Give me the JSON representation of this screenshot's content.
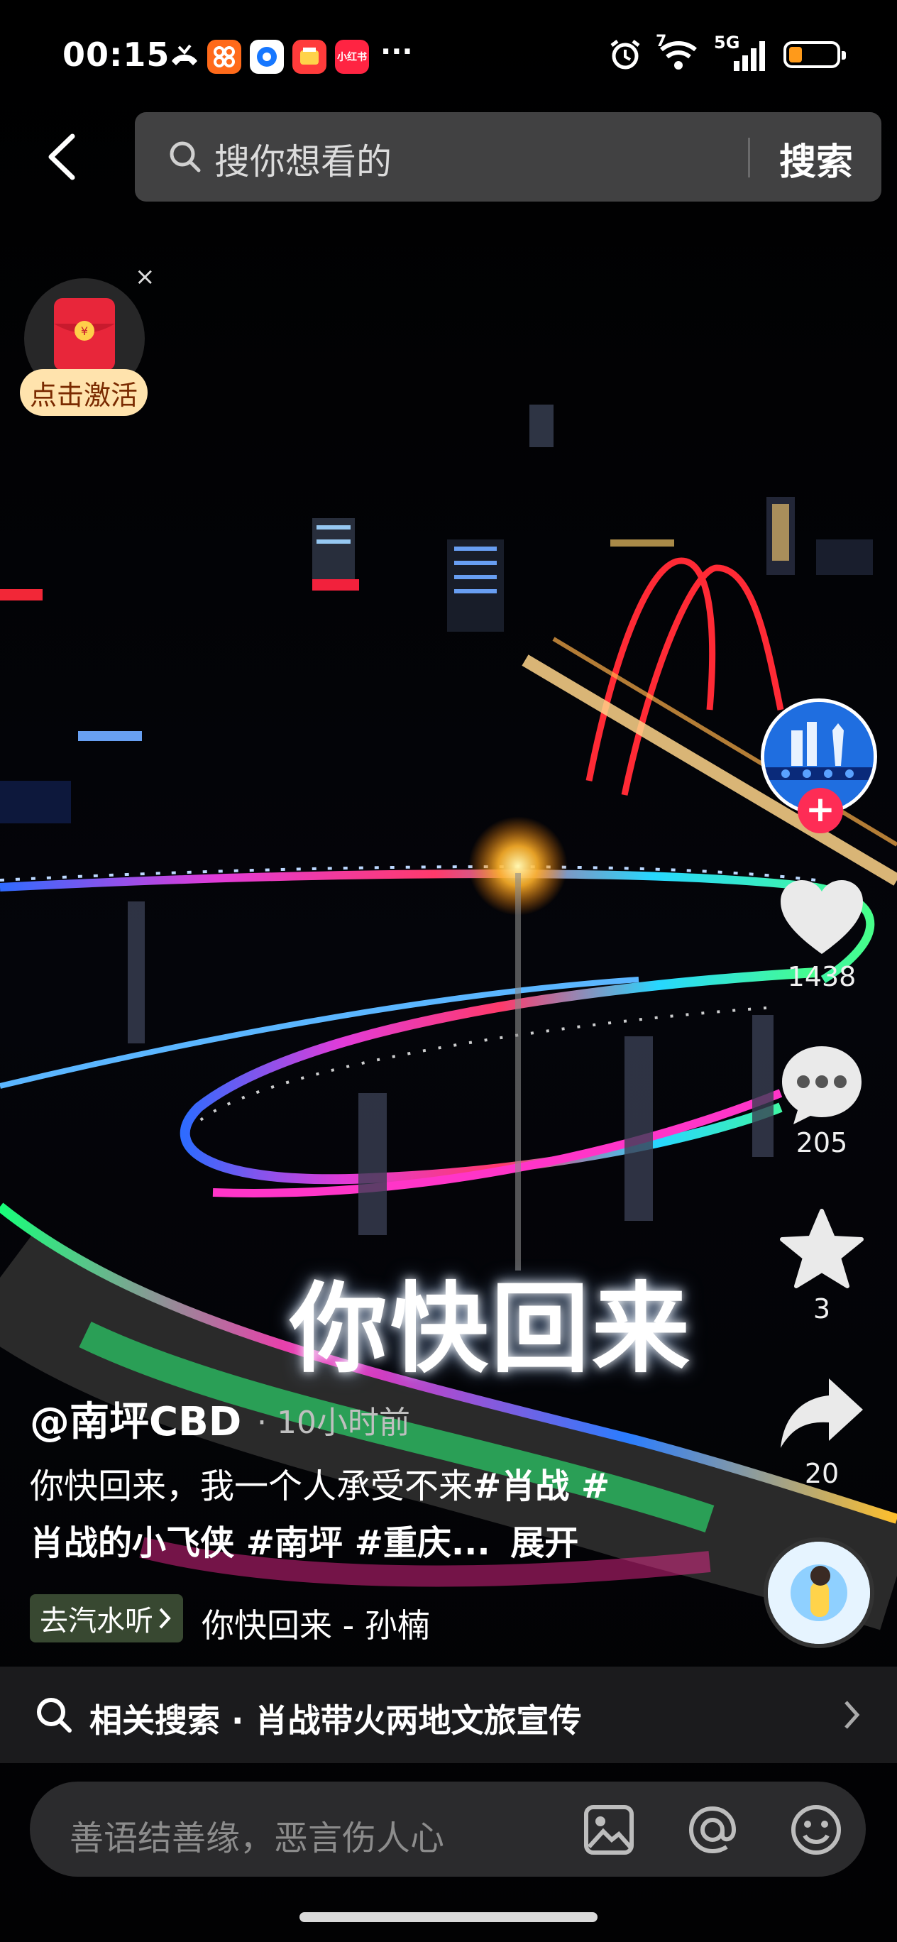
{
  "status_bar": {
    "time": "00:15",
    "app_badges": [
      "app-1",
      "app-2",
      "app-3",
      "小红书"
    ],
    "more": "···",
    "network": "5G",
    "signal_sub": "7",
    "battery_color": "#ff9a1a"
  },
  "search": {
    "placeholder": "搜你想看的",
    "button": "搜索"
  },
  "promo": {
    "label": "点击激活",
    "close": "×"
  },
  "video": {
    "overlay_text": "你快回来"
  },
  "actions": {
    "like_count": "1438",
    "comment_count": "205",
    "favorite_count": "3",
    "share_count": "20"
  },
  "post": {
    "username": "@南坪CBD",
    "time_ago": "· 10小时前",
    "caption_line1_text": "你快回来，我一个人承受不来",
    "caption_line1_tags": "#肖战 #",
    "caption_line2": "肖战的小飞侠 #南坪 #重庆...",
    "expand": "展开",
    "music_chip": "去汽水听",
    "music_title": "你快回来 - 孙楠"
  },
  "related": {
    "text": "相关搜索 · 肖战带火两地文旅宣传"
  },
  "comment": {
    "placeholder": "善语结善缘，恶言伤人心"
  },
  "colors": {
    "accent_red": "#fe2c55",
    "promo_bg": "#ffe3ad"
  }
}
